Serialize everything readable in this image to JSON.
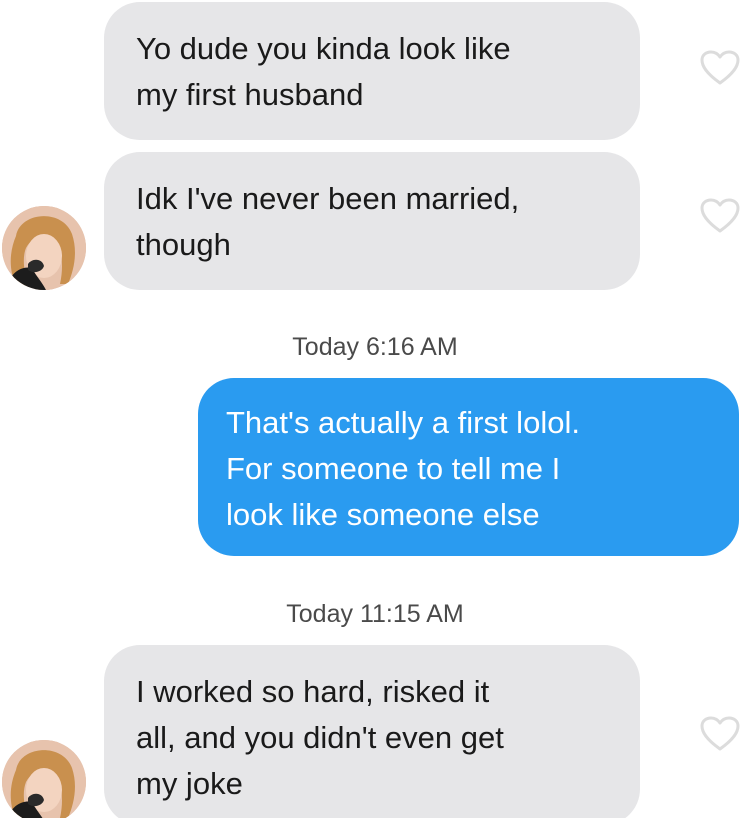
{
  "messages": [
    {
      "lines": [
        "Yo dude you kinda look like",
        "my first husband"
      ],
      "sender": "them"
    },
    {
      "lines": [
        "Idk I've never been married,",
        "though"
      ],
      "sender": "them"
    },
    {
      "lines": [
        "That's actually a first lolol.",
        "For someone to tell me I",
        "look like someone else"
      ],
      "sender": "me"
    },
    {
      "lines": [
        "I worked so hard, risked it",
        "all, and you didn't even get",
        "my joke"
      ],
      "sender": "them"
    }
  ],
  "timestamps": [
    "Today 6:16 AM",
    "Today 11:15 AM"
  ],
  "icons": {
    "reaction": "heart-outline-icon",
    "contact_avatar": "contact-avatar"
  },
  "colors": {
    "incoming_bubble": "#e6e6e8",
    "outgoing_bubble": "#2a9bf0",
    "outgoing_text": "#ffffff",
    "timestamp_text": "#4a4a4a",
    "heart_outline": "#dcdcdc"
  }
}
